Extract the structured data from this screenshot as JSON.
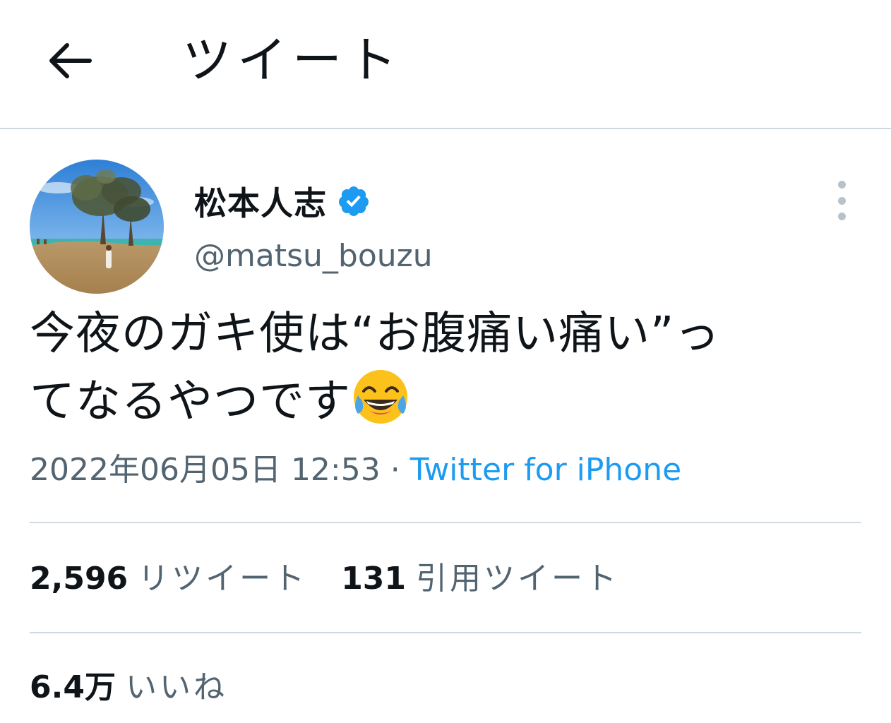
{
  "header": {
    "title": "ツイート",
    "back_icon": "arrow-left-icon"
  },
  "author": {
    "display_name": "松本人志",
    "handle": "@matsu_bouzu",
    "verified": true,
    "verified_color": "#1d9bf0"
  },
  "tweet": {
    "text_line1": "今夜のガキ使は“お腹痛い痛い”っ",
    "text_line2": "てなるやつです",
    "emoji": "face-with-tears-of-joy",
    "timestamp": "2022年06月05日 12:53",
    "separator": " · ",
    "source": "Twitter for iPhone"
  },
  "stats": {
    "retweets_count": "2,596",
    "retweets_label": "リツイート",
    "quotes_count": "131",
    "quotes_label": "引用ツイート",
    "likes_count": "6.4万",
    "likes_label": "いいね"
  },
  "colors": {
    "text": "#0f1419",
    "secondary": "#536471",
    "link": "#1d9bf0",
    "divider": "#cfd9de"
  }
}
